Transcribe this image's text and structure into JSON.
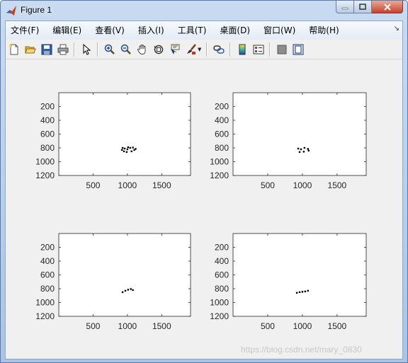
{
  "window": {
    "title": "Figure 1"
  },
  "menu": [
    {
      "label": "文件(F)"
    },
    {
      "label": "编辑(E)"
    },
    {
      "label": "查看(V)"
    },
    {
      "label": "插入(I)"
    },
    {
      "label": "工具(T)"
    },
    {
      "label": "桌面(D)"
    },
    {
      "label": "窗口(W)"
    },
    {
      "label": "帮助(H)"
    }
  ],
  "toolbar_icons": [
    "new-figure-icon",
    "open-file-icon",
    "save-icon",
    "print-icon",
    "pointer-icon",
    "zoom-in-icon",
    "zoom-out-icon",
    "pan-icon",
    "rotate-3d-icon",
    "data-cursor-icon",
    "brush-icon",
    "link-plot-icon",
    "colorbar-icon",
    "legend-icon",
    "hide-plot-tools-icon",
    "show-plot-tools-icon"
  ],
  "watermark": "https://blog.csdn.net/mary_0830",
  "chart_data": [
    {
      "type": "scatter",
      "position": "top-left",
      "grid": false,
      "x_ticks": [
        "500",
        "1000",
        "1500"
      ],
      "y_ticks": [
        "200",
        "400",
        "600",
        "800",
        "1000",
        "1200"
      ],
      "xlim": [
        0,
        1920
      ],
      "ylim": [
        0,
        1200
      ],
      "y_direction": "reversed",
      "points": [
        [
          930,
          800
        ],
        [
          960,
          810
        ],
        [
          1000,
          820
        ],
        [
          1040,
          800
        ],
        [
          1080,
          795
        ],
        [
          950,
          850
        ],
        [
          990,
          860
        ],
        [
          1060,
          850
        ],
        [
          1100,
          830
        ],
        [
          920,
          830
        ],
        [
          1010,
          790
        ],
        [
          1120,
          815
        ]
      ]
    },
    {
      "type": "scatter",
      "position": "top-right",
      "grid": false,
      "x_ticks": [
        "500",
        "1000",
        "1500"
      ],
      "y_ticks": [
        "200",
        "400",
        "600",
        "800",
        "1000",
        "1200"
      ],
      "xlim": [
        0,
        1920
      ],
      "ylim": [
        0,
        1200
      ],
      "y_direction": "reversed",
      "points": [
        [
          940,
          810
        ],
        [
          980,
          820
        ],
        [
          1030,
          800
        ],
        [
          1080,
          815
        ],
        [
          960,
          860
        ],
        [
          1020,
          855
        ],
        [
          1090,
          840
        ]
      ]
    },
    {
      "type": "scatter",
      "position": "bottom-left",
      "grid": false,
      "x_ticks": [
        "500",
        "1000",
        "1500"
      ],
      "y_ticks": [
        "200",
        "400",
        "600",
        "800",
        "1000",
        "1200"
      ],
      "xlim": [
        0,
        1920
      ],
      "ylim": [
        0,
        1200
      ],
      "y_direction": "reversed",
      "points": [
        [
          930,
          850
        ],
        [
          970,
          830
        ],
        [
          1010,
          815
        ],
        [
          1050,
          805
        ],
        [
          1080,
          820
        ]
      ]
    },
    {
      "type": "scatter",
      "position": "bottom-right",
      "grid": false,
      "x_ticks": [
        "500",
        "1000",
        "1500"
      ],
      "y_ticks": [
        "200",
        "400",
        "600",
        "800",
        "1000",
        "1200"
      ],
      "xlim": [
        0,
        1920
      ],
      "ylim": [
        0,
        1200
      ],
      "y_direction": "reversed",
      "points": [
        [
          920,
          860
        ],
        [
          960,
          850
        ],
        [
          1000,
          845
        ],
        [
          1040,
          840
        ],
        [
          1080,
          830
        ]
      ]
    }
  ]
}
